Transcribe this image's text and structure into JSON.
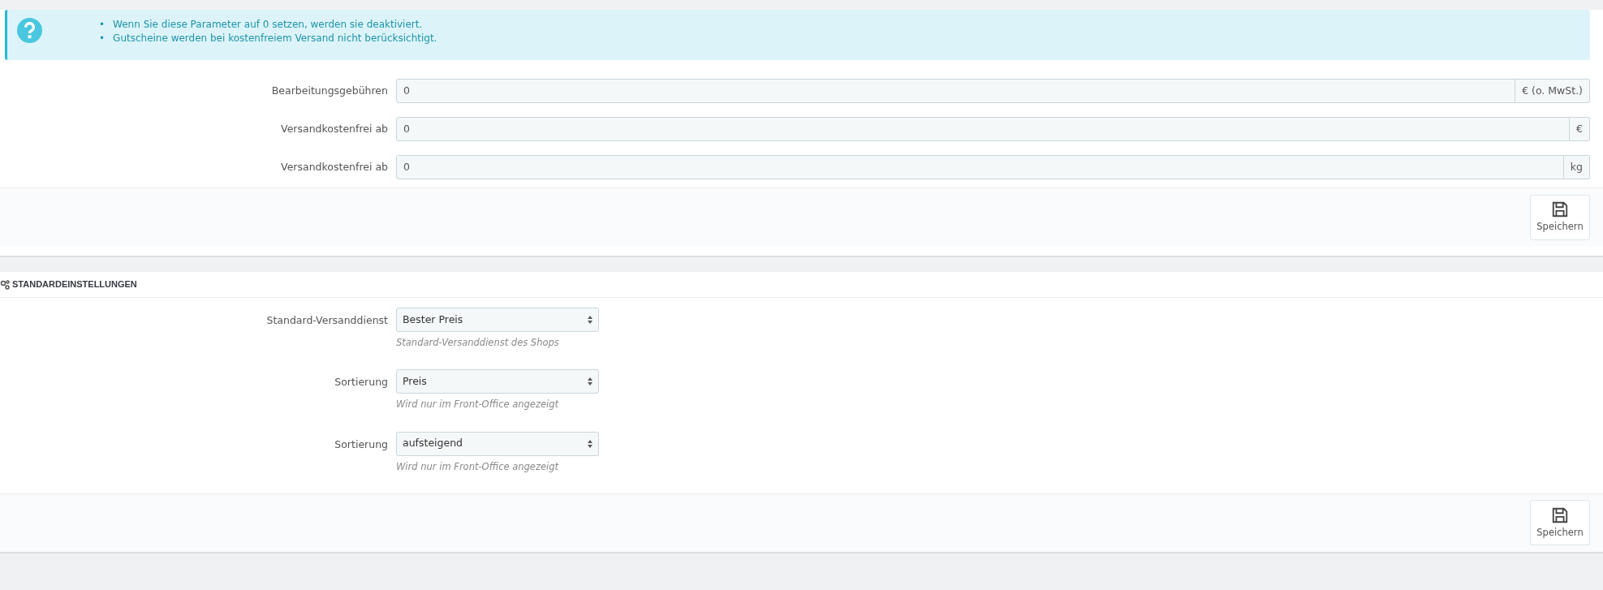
{
  "info": {
    "bullet": "•",
    "items": [
      "Wenn Sie diese Parameter auf 0 setzen, werden sie deaktiviert.",
      "Gutscheine werden bei kostenfreiem Versand nicht berücksichtigt."
    ]
  },
  "fees": [
    {
      "label": "Bearbeitungsgebühren",
      "value": "0",
      "suffix": "€ (o. MwSt.)"
    },
    {
      "label": "Versandkostenfrei ab",
      "value": "0",
      "suffix": "€"
    },
    {
      "label": "Versandkostenfrei ab",
      "value": "0",
      "suffix": "kg"
    }
  ],
  "save_button_1": "Speichern",
  "defaults": {
    "title": "STANDARDEINSTELLUNGEN",
    "fields": [
      {
        "label": "Standard-Versanddienst",
        "value": "Bester Preis",
        "help": "Standard-Versanddienst des Shops"
      },
      {
        "label": "Sortierung",
        "value": "Preis",
        "help": "Wird nur im Front-Office angezeigt"
      },
      {
        "label": "Sortierung",
        "value": "aufsteigend",
        "help": "Wird nur im Front-Office angezeigt"
      }
    ]
  },
  "save_button_2": "Speichern"
}
